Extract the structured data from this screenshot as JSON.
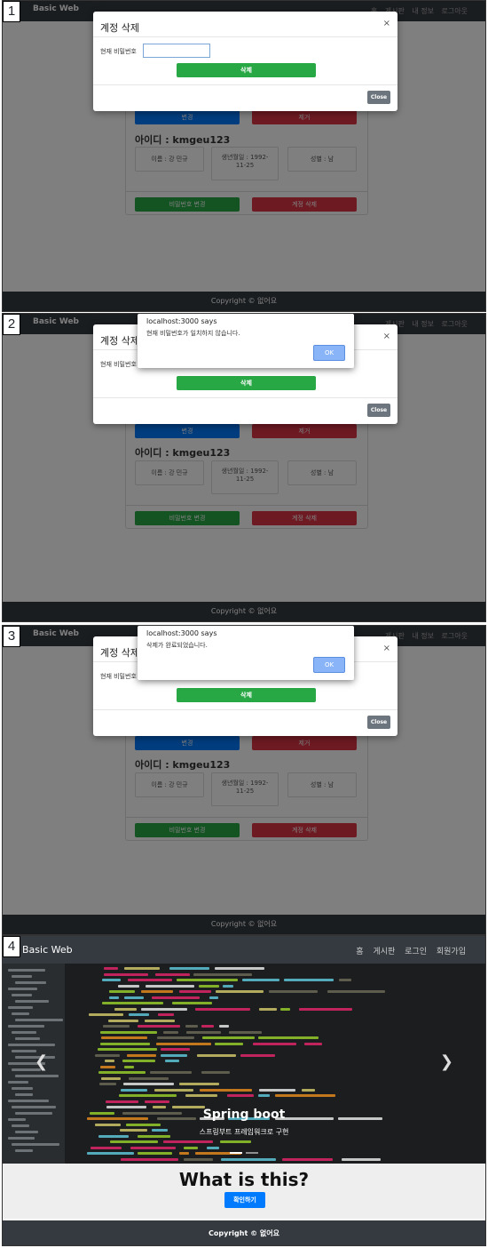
{
  "nav": {
    "brand": "Basic Web",
    "links": [
      "홈",
      "게시판",
      "내 정보",
      "로그아웃"
    ]
  },
  "mypage": {
    "change_label": "변경",
    "remove_label": "제거",
    "id_label": "아이디 : kmgeu123",
    "name": "이름 : 강 민규",
    "birth_line1": "생년월일 : 1992-",
    "birth_line2": "11-25",
    "gender": "성별 : 남",
    "change_password_label": "비밀번호 변경",
    "delete_account_label": "계정 삭제"
  },
  "footer": {
    "text": "Copyright © 없어요"
  },
  "modal": {
    "title": "계정 삭제",
    "close_x": "×",
    "password_label": "현재 비밀번호",
    "password_label_truncated": "현재 비밀번호",
    "password_value": "",
    "submit_label": "삭제",
    "close_label": "Close"
  },
  "alerts": [
    {
      "origin": "localhost:3000 says",
      "message": "현재 비밀번호가 일치하지 않습니다.",
      "ok": "OK"
    },
    {
      "origin": "localhost:3000 says",
      "message": "삭제가 완료되었습니다.",
      "ok": "OK"
    }
  ],
  "panel_numbers": [
    "1",
    "2",
    "3",
    "4"
  ],
  "home": {
    "brand": "Basic Web",
    "links": [
      "홈",
      "게시판",
      "로그인",
      "회원가입"
    ],
    "hero_title": "Spring boot",
    "hero_subtitle": "스프링부트 프레임워크로 구현",
    "prev_icon": "chevron-left-icon",
    "next_icon": "chevron-right-icon",
    "question": "What is this?",
    "confirm_label": "확인하기",
    "footer": "Copyright © 없어요"
  },
  "colors": {
    "navbar": "#343a40",
    "primary": "#007bff",
    "danger": "#dc3545",
    "success": "#28a745",
    "secondary": "#6c757d"
  }
}
